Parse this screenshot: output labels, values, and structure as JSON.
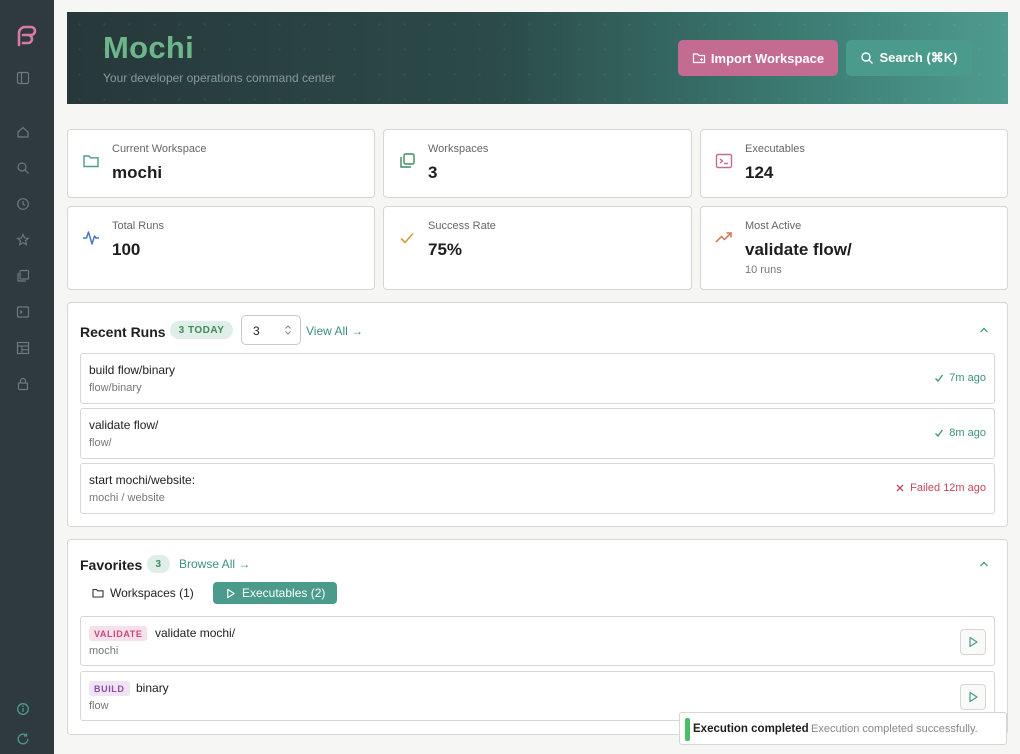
{
  "sidebar": {
    "icons": [
      "logo-icon",
      "panel-toggle-icon",
      "home-icon",
      "search-icon",
      "history-icon",
      "star-icon",
      "workspaces-icon",
      "terminal-icon",
      "layout-icon",
      "lock-icon",
      "info-icon",
      "refresh-icon"
    ]
  },
  "header": {
    "title": "Mochi",
    "subtitle": "Your developer operations command center",
    "import_label": "Import Workspace",
    "search_label": "Search (⌘K)"
  },
  "stats": [
    {
      "label": "Current Workspace",
      "value": "mochi",
      "icon": "folder-icon"
    },
    {
      "label": "Workspaces",
      "value": "3",
      "icon": "stack-icon"
    },
    {
      "label": "Executables",
      "value": "124",
      "icon": "terminal-icon"
    },
    {
      "label": "Total Runs",
      "value": "100",
      "icon": "activity-icon"
    },
    {
      "label": "Success Rate",
      "value": "75%",
      "icon": "check-icon"
    },
    {
      "label": "Most Active",
      "value": "validate flow/",
      "sub": "10 runs",
      "icon": "trending-up-icon"
    }
  ],
  "recent_runs": {
    "title": "Recent Runs",
    "badge": "3 TODAY",
    "count_select": "3",
    "view_all": "View All →",
    "items": [
      {
        "name": "build flow/binary",
        "path": "flow/binary",
        "status": "7m ago",
        "ok": true
      },
      {
        "name": "validate flow/",
        "path": "flow/",
        "status": "8m ago",
        "ok": true
      },
      {
        "name": "start mochi/website:",
        "path": "mochi / website",
        "status": "Failed 12m ago",
        "ok": false
      }
    ]
  },
  "favorites": {
    "title": "Favorites",
    "count": "3",
    "browse_all": "Browse All →",
    "tabs": [
      {
        "label": "Workspaces (1)",
        "active": false
      },
      {
        "label": "Executables (2)",
        "active": true
      }
    ],
    "items": [
      {
        "tag": "VALIDATE",
        "name": "validate mochi/",
        "path": "mochi"
      },
      {
        "tag": "BUILD",
        "name": "binary",
        "path": "flow"
      }
    ]
  },
  "toast": {
    "title": "Execution completed",
    "message": "Execution completed successfully."
  },
  "colors": {
    "accent": "#4a9b8c",
    "brand_pink": "#c46b92",
    "title_green": "#6fb58c",
    "fail_red": "#c4485a",
    "sidebar": "#2f3a3e"
  }
}
